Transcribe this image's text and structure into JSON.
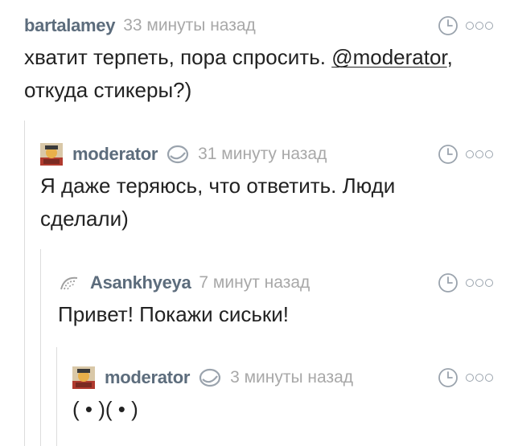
{
  "comments": [
    {
      "author": "bartalamey",
      "time": "33 минуты назад",
      "text_parts": [
        "хватит терпеть, пора спросить. ",
        "@moderator",
        ","
      ],
      "text_line2": "откуда стикеры?)",
      "avatar": "none",
      "actions": {
        "clock_icon": "clock-icon",
        "more_icon": "more-options-icon"
      }
    },
    {
      "author": "moderator",
      "author_badge_icon": "moderator-badge-icon",
      "time": "31 минуту назад",
      "text_line1": "Я даже теряюсь, что ответить. Люди",
      "text_line2": "сделали)",
      "avatar": "moderator-avatar",
      "actions": {
        "clock_icon": "clock-icon",
        "more_icon": "more-options-icon"
      }
    },
    {
      "author": "Asankhyeya",
      "time": "7 минут назад",
      "text_line1": "Привет! Покажи сиськи!",
      "avatar": "asankhyeya-avatar",
      "actions": {
        "clock_icon": "clock-icon",
        "more_icon": "more-options-icon"
      }
    },
    {
      "author": "moderator",
      "author_badge_icon": "moderator-badge-icon",
      "time": "3 минуты назад",
      "text_line1": "( • )( • )",
      "avatar": "moderator-avatar",
      "actions": {
        "clock_icon": "clock-icon",
        "more_icon": "more-options-icon"
      }
    }
  ],
  "colors": {
    "author": "#5c6c7c",
    "timestamp": "#a8a8a8",
    "text": "#222222",
    "thread_line": "#dcdcdc",
    "icon": "#9aa3ad"
  }
}
